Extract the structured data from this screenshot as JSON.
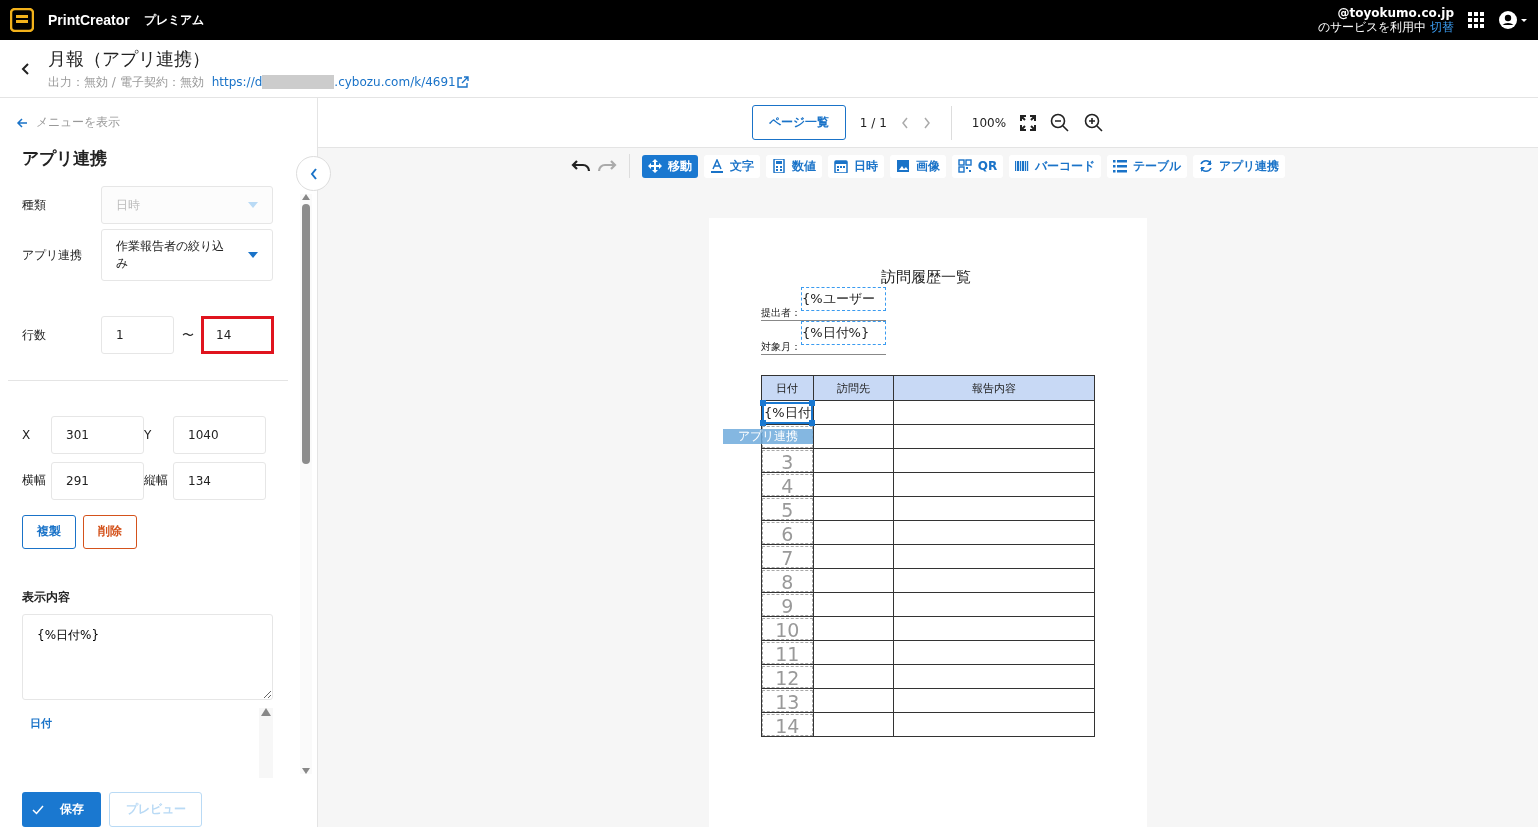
{
  "app_bar": {
    "product": "PrintCreator",
    "plan": "プレミアム",
    "account_email": "@toyokumo.co.jp",
    "account_status": "のサービスを利用中",
    "switch_link": "切替"
  },
  "header": {
    "title": "月報（アプリ連携）",
    "meta": "出力：無効 / 電子契約：無効",
    "link_start": "https://d",
    "link_end": ".cybozu.com/k/4691"
  },
  "sidebar": {
    "back_link": "メニューを表示",
    "heading": "アプリ連携",
    "selects": [
      {
        "label": "種類",
        "value": "日時",
        "disabled": true
      },
      {
        "label": "アプリ連携",
        "value": "作業報告者の絞り込み",
        "disabled": false
      }
    ],
    "row_range": {
      "label": "行数",
      "from": "1",
      "separator": "〜",
      "to": "14",
      "highlighted": true
    },
    "geometry": [
      {
        "label": "X",
        "value": "301"
      },
      {
        "label": "Y",
        "value": "1040"
      },
      {
        "label": "横幅",
        "value": "291"
      },
      {
        "label": "縦幅",
        "value": "134"
      }
    ],
    "copy_button": "複製",
    "delete_button": "削除",
    "content_label": "表示内容",
    "content_value": "{%日付%}",
    "field_options": [
      "日付"
    ],
    "save_button": "保存",
    "preview_button": {
      "label": "プレビュー",
      "disabled": true
    }
  },
  "viewer": {
    "page_list_button": "ページ一覧",
    "page_indicator": "1 / 1",
    "zoom": "100%"
  },
  "tools": [
    {
      "kind": "move",
      "label": "移動",
      "selected": true
    },
    {
      "kind": "text",
      "label": "文字",
      "selected": false
    },
    {
      "kind": "number",
      "label": "数値",
      "selected": false
    },
    {
      "kind": "date",
      "label": "日時",
      "selected": false
    },
    {
      "kind": "image",
      "label": "画像",
      "selected": false
    },
    {
      "kind": "qr",
      "label": "QR",
      "selected": false
    },
    {
      "kind": "barcode",
      "label": "バーコード",
      "selected": false
    },
    {
      "kind": "table",
      "label": "テーブル",
      "selected": false
    },
    {
      "kind": "link",
      "label": "アプリ連携",
      "selected": false
    }
  ],
  "document": {
    "title": "訪問履歴一覧",
    "fields": [
      {
        "label": "提出者：",
        "value": "{%ユーザー"
      },
      {
        "label": "対象月：",
        "value": "{%日付%}"
      }
    ],
    "table": {
      "columns": [
        "日付",
        "訪問先",
        "報告内容"
      ],
      "selected_cell": "{%日付",
      "selection_tag": "アプリ連携",
      "row_numbers": [
        "3",
        "4",
        "5",
        "6",
        "7",
        "8",
        "9",
        "10",
        "11",
        "12",
        "13",
        "14"
      ]
    }
  }
}
